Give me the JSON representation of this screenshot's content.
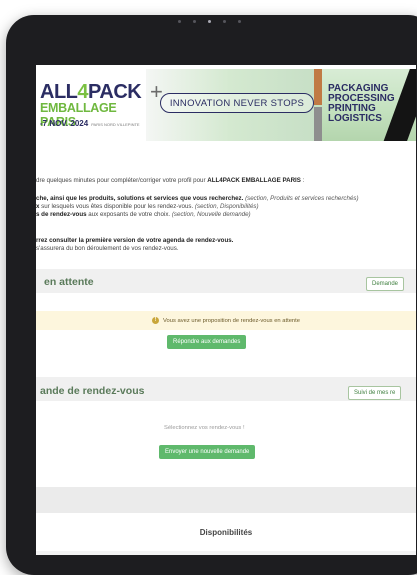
{
  "banner": {
    "brand_main": "ALL",
    "brand_four": "4",
    "brand_end": "PACK",
    "brand_sub": "EMBALLAGE PARIS",
    "brand_date": "-7 NOV. 2024",
    "brand_venue": "PARIS NORD VILLEPINTE",
    "slogan": "INNOVATION NEVER STOPS",
    "words": [
      "PACKAGING",
      "PROCESSING",
      "PRINTING",
      "LOGISTICS"
    ]
  },
  "intro": {
    "line1_prefix": "dre quelques minutes pour compléter/corriger votre profil pour ",
    "line1_event": "ALL4PACK EMBALLAGE PARIS",
    "line1_suffix": " :",
    "line2_bold": "che, ainsi que les produits, solutions et services que vous recherchez.",
    "line2_italic": " (section, Produits et services recherchés)",
    "line3_bold": "x",
    "line3_text": " sur lesquels vous êtes disponible pour les rendez-vous.",
    "line3_italic": " (section, Disponibilités)",
    "line4_bold": "s de rendez-vous",
    "line4_text": " aux exposants de votre choix.",
    "line4_italic": " (section, Nouvelle demande)",
    "line5_bold": "rrez consulter la première version de votre agenda de rendez-vous.",
    "line6_text": "s'assurera du bon déroulement de vos rendez-vous."
  },
  "pending": {
    "title": "en attente",
    "header_button": "Demande",
    "alert_text": "Vous avez une proposition de rendez-vous en attente",
    "action_button": "Répondre aux demandes"
  },
  "new_request": {
    "title": "ande de rendez-vous",
    "header_button": "Suivi de mes re",
    "empty_text": "Sélectionnez vos rendez-vous !",
    "action_button": "Envoyer une nouvelle demande"
  },
  "availability": {
    "title": "Disponibilités"
  },
  "colors": {
    "navy": "#2b2d63",
    "brand_green": "#7bc142",
    "button_green": "#5fb96c",
    "alert_bg": "#fdf6dd"
  }
}
